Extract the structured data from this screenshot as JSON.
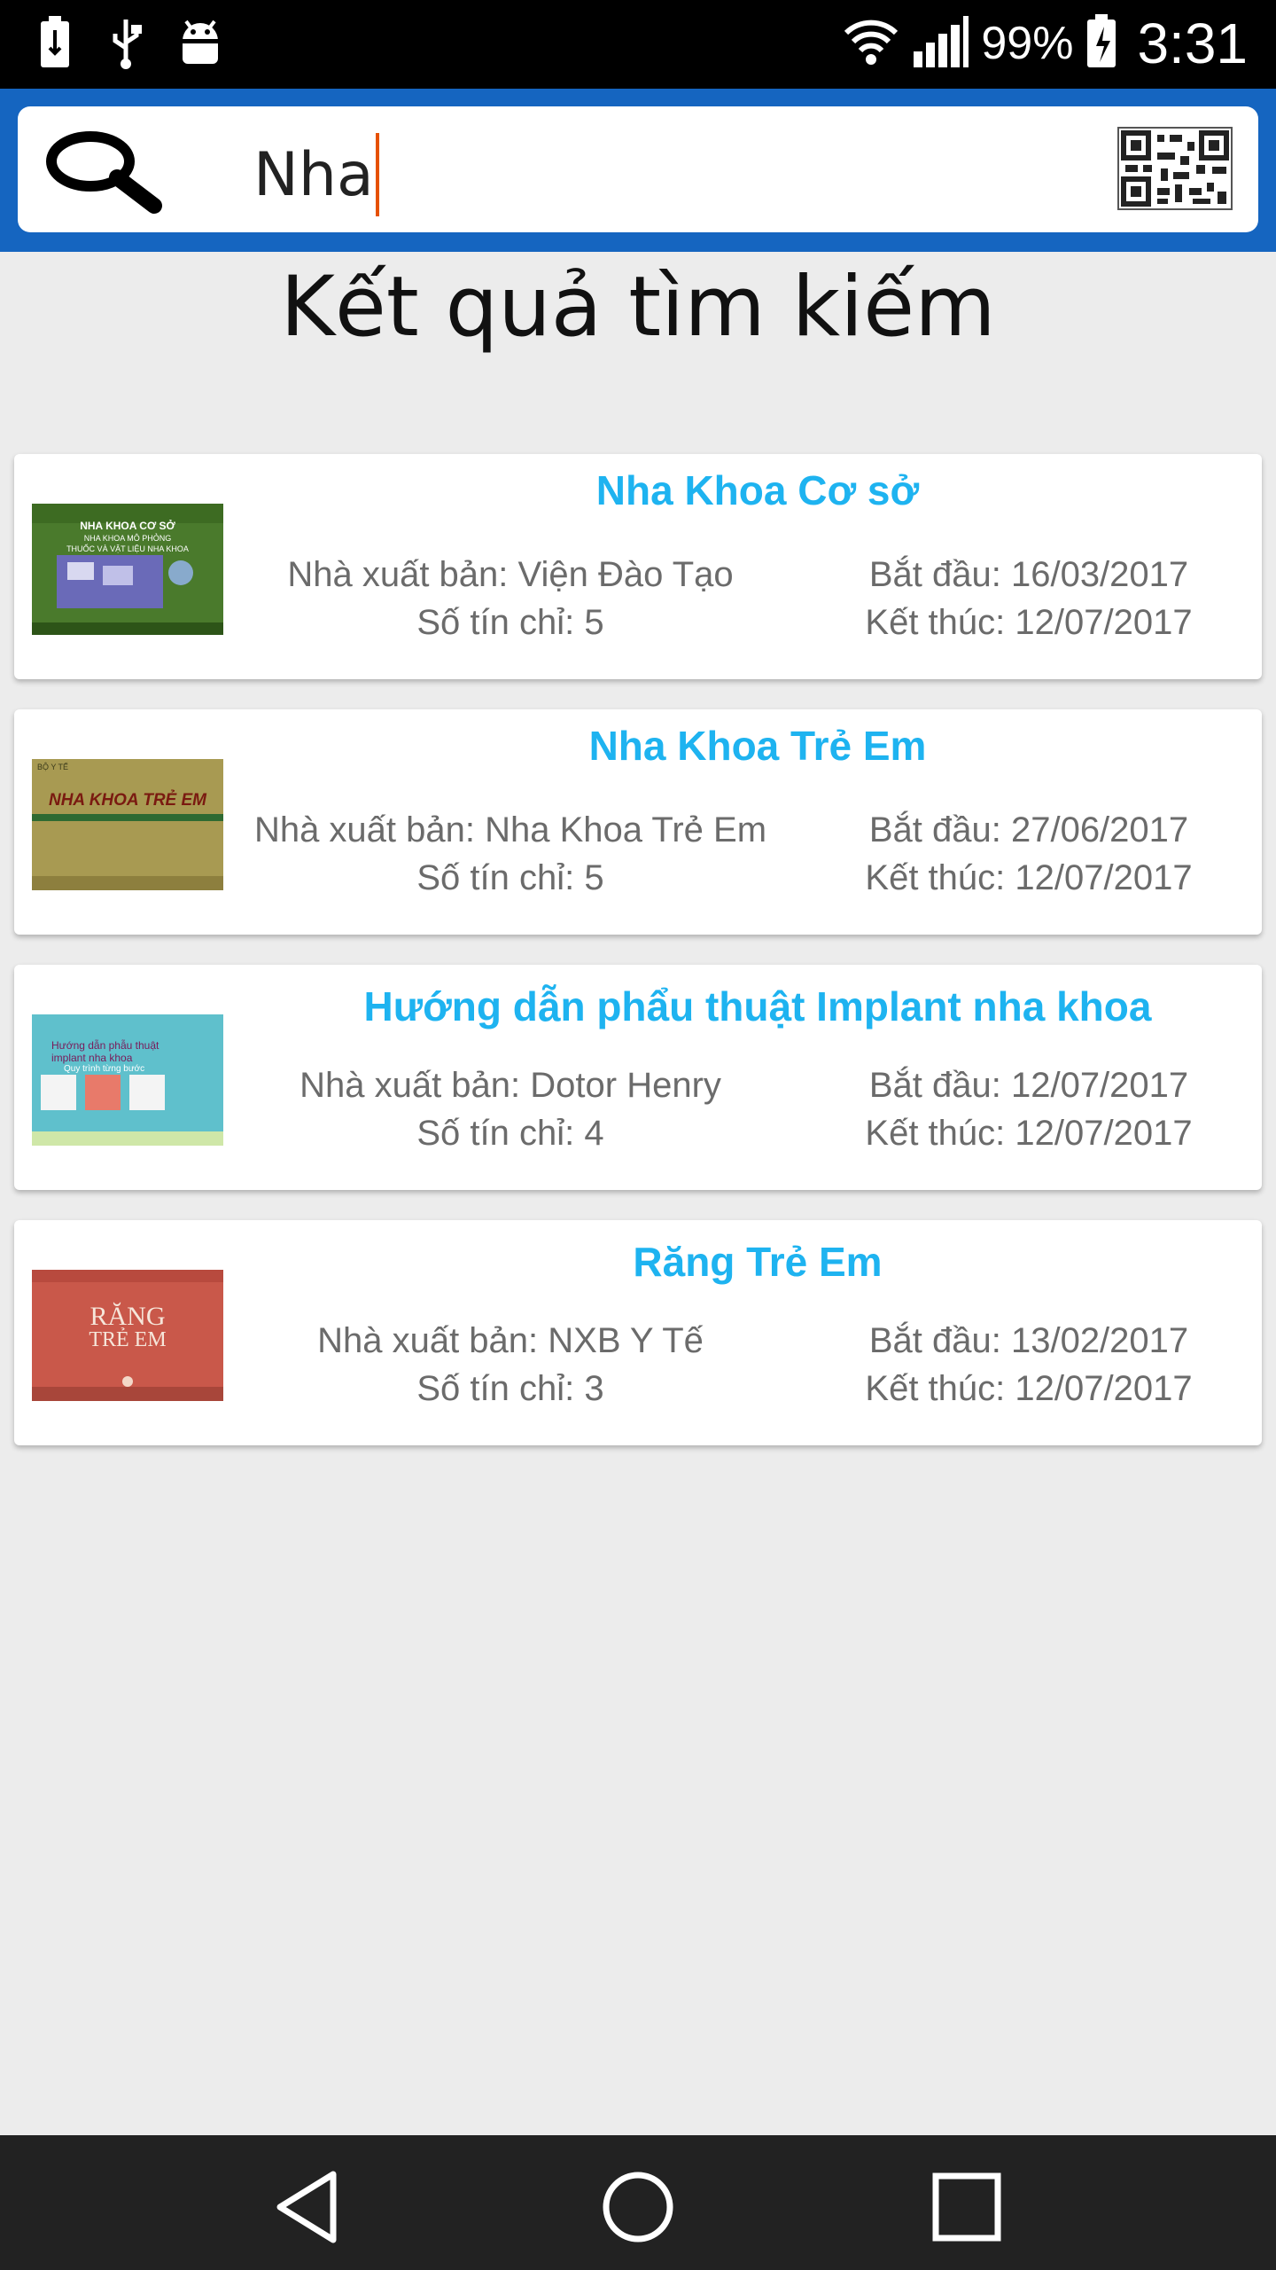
{
  "status_bar": {
    "battery_percent": "99%",
    "time": "3:31",
    "icons": [
      "battery-saver-icon",
      "usb-icon",
      "android-debug-icon",
      "wifi-icon",
      "signal-icon",
      "battery-charging-icon"
    ]
  },
  "search": {
    "query": "Nha",
    "icons": {
      "left": "search-icon",
      "right": "qr-code-icon"
    }
  },
  "page": {
    "title": "Kết quả tìm kiếm"
  },
  "results": [
    {
      "title": "Nha Khoa Cơ sở",
      "publisher": "Nhà xuất bản: Viện Đào Tạo",
      "credits": "Số tín chỉ: 5",
      "start": "Bắt đầu: 16/03/2017",
      "end": "Kết thúc: 12/07/2017",
      "cover_lines": [
        "NHA KHOA CƠ SỞ",
        "NHA KHOA MÔ PHỎNG",
        "THUỐC VÀ VẬT LIỆU NHA KHOA"
      ]
    },
    {
      "title": "Nha Khoa Trẻ Em",
      "publisher": "Nhà xuất bản: Nha Khoa Trẻ Em",
      "credits": "Số tín chỉ: 5",
      "start": "Bắt đầu: 27/06/2017",
      "end": "Kết thúc: 12/07/2017",
      "cover_lines": [
        "BỘ Y TẾ",
        "NHA KHOA TRẺ EM"
      ]
    },
    {
      "title": "Hướng dẫn phẩu thuật Implant nha khoa",
      "publisher": "Nhà xuất bản: Dotor Henry",
      "credits": "Số tín chỉ: 4",
      "start": "Bắt đầu: 12/07/2017",
      "end": "Kết thúc: 12/07/2017",
      "cover_lines": [
        "Hướng dẫn phẫu thuật",
        "implant nha khoa",
        "Quy trình từng bước"
      ]
    },
    {
      "title": "Răng Trẻ Em",
      "publisher": "Nhà xuất bản: NXB Y Tế",
      "credits": "Số tín chỉ: 3",
      "start": "Bắt đầu: 13/02/2017",
      "end": "Kết thúc: 12/07/2017",
      "cover_lines": [
        "RĂNG",
        "TRẺ EM"
      ]
    }
  ],
  "nav": {
    "icons": [
      "back-icon",
      "home-icon",
      "recents-icon"
    ]
  },
  "colors": {
    "header": "#1565c0",
    "title_accent": "#1eb3f0",
    "caret": "#e65100"
  }
}
